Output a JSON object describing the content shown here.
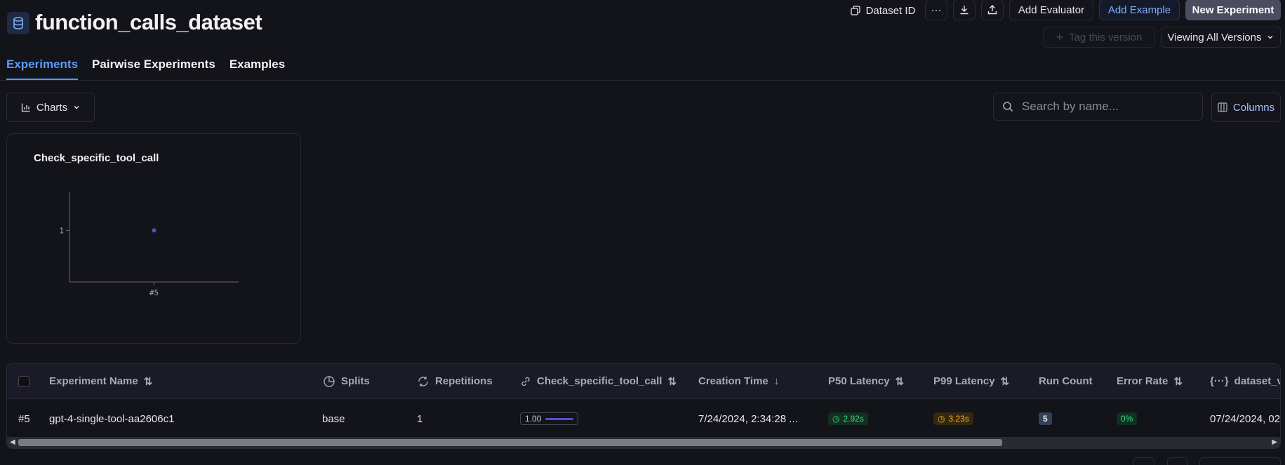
{
  "header": {
    "title": "function_calls_dataset",
    "dataset_id_label": "Dataset ID",
    "more_label": "···",
    "add_evaluator_label": "Add Evaluator",
    "add_example_label": "Add Example",
    "new_experiment_label": "New Experiment",
    "tag_version_label": "Tag this version",
    "version_select_label": "Viewing All Versions"
  },
  "tabs": [
    {
      "label": "Experiments",
      "active": true
    },
    {
      "label": "Pairwise Experiments",
      "active": false
    },
    {
      "label": "Examples",
      "active": false
    }
  ],
  "toolbar": {
    "charts_label": "Charts",
    "search_placeholder": "Search by name...",
    "columns_label": "Columns"
  },
  "chart_data": {
    "type": "scatter",
    "title": "Check_specific_tool_call",
    "categories": [
      "#5"
    ],
    "values": [
      1
    ],
    "y_ticks": [
      "1"
    ],
    "x_ticks": [
      "#5"
    ],
    "color": "#5a4cc9"
  },
  "table": {
    "columns": [
      {
        "label": "Experiment Name"
      },
      {
        "label": "Splits"
      },
      {
        "label": "Repetitions"
      },
      {
        "label": "Check_specific_tool_call"
      },
      {
        "label": "Creation Time"
      },
      {
        "label": "P50 Latency"
      },
      {
        "label": "P99 Latency"
      },
      {
        "label": "Run Count"
      },
      {
        "label": "Error Rate"
      },
      {
        "label": "dataset_ve"
      }
    ],
    "rows": [
      {
        "id": "#5",
        "name": "gpt-4-single-tool-aa2606c1",
        "splits": "base",
        "repetitions": "1",
        "score": "1.00",
        "creation_time": "7/24/2024, 2:34:28 ...",
        "p50": "2.92s",
        "p99": "3.23s",
        "run_count": "5",
        "error_rate": "0%",
        "dataset_version": "07/24/2024, 02"
      }
    ]
  },
  "colors": {
    "accent": "#5b9bff",
    "success": "#3ddc84",
    "warning": "#f0b429",
    "chart": "#5a4cc9"
  }
}
